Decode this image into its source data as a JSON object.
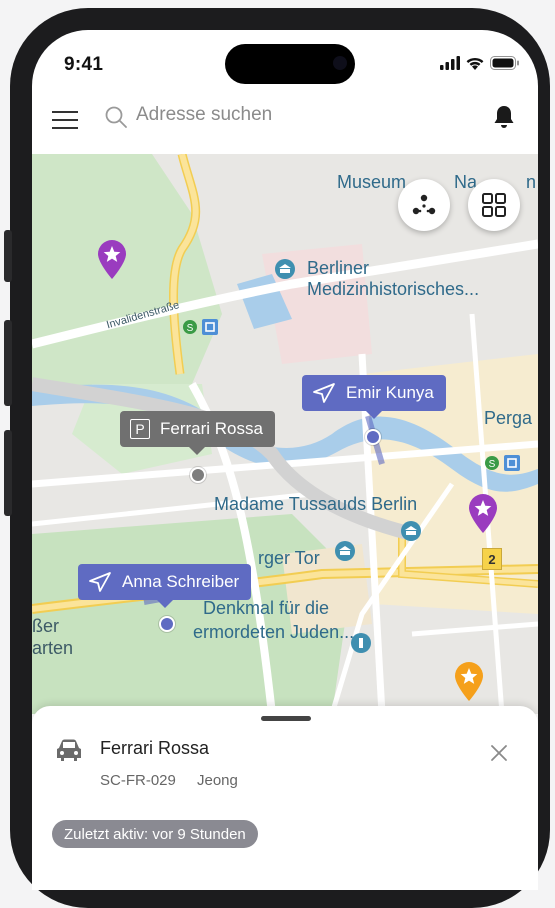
{
  "status_bar": {
    "time": "9:41"
  },
  "header": {
    "search_placeholder": "Adresse suchen"
  },
  "map": {
    "labels": {
      "museum": "Museum",
      "museum_tail": "Na",
      "museum_tail2": "n",
      "berliner": "Berliner",
      "medizin": "Medizinhistorisches...",
      "pergamon": "Perga",
      "tussauds": "Madame Tussauds Berlin",
      "tor": "rger Tor",
      "denkmal1": "Denkmal für die",
      "denkmal2": "ermordeten Juden...",
      "sser": "ßer",
      "arten": "arten",
      "street": "Invalidenstraße",
      "road_number": "2"
    },
    "callouts": {
      "vehicle": "Ferrari Rossa",
      "vehicle_icon_letter": "P",
      "person1": "Emir Kunya",
      "person2": "Anna Schreiber"
    },
    "colors": {
      "person": "#5f6bc2",
      "vehicle": "#707070",
      "poi_purple": "#9a3cbf",
      "poi_orange": "#f5a01b"
    }
  },
  "sheet": {
    "vehicle_name": "Ferrari Rossa",
    "plate": "SC-FR-029",
    "driver": "Jeong",
    "status": "Zuletzt aktiv: vor 9 Stunden"
  }
}
